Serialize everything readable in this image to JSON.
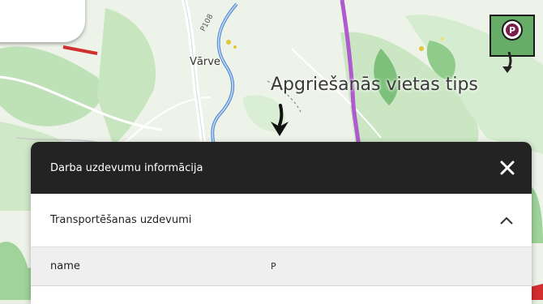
{
  "map": {
    "place_label": "Vārve",
    "road_label": "P108",
    "parking_marker_letter": "P"
  },
  "annotation": {
    "text": "Apgriešanās vietas tips"
  },
  "panel": {
    "title": "Darba uzdevumu informācija",
    "close_icon": "close-icon",
    "section": {
      "title": "Transportēšanas uzdevumi",
      "toggle_icon": "chevron-up-icon"
    },
    "rows": [
      {
        "key": "name",
        "value": "P"
      }
    ]
  },
  "colors": {
    "panel_header_bg": "#232323",
    "row_bg": "#efefef",
    "river": "#5b8fd6",
    "forest": "#7cc07a",
    "purple_route": "#b05ad0",
    "parking_marker": "#7a1f4b"
  }
}
